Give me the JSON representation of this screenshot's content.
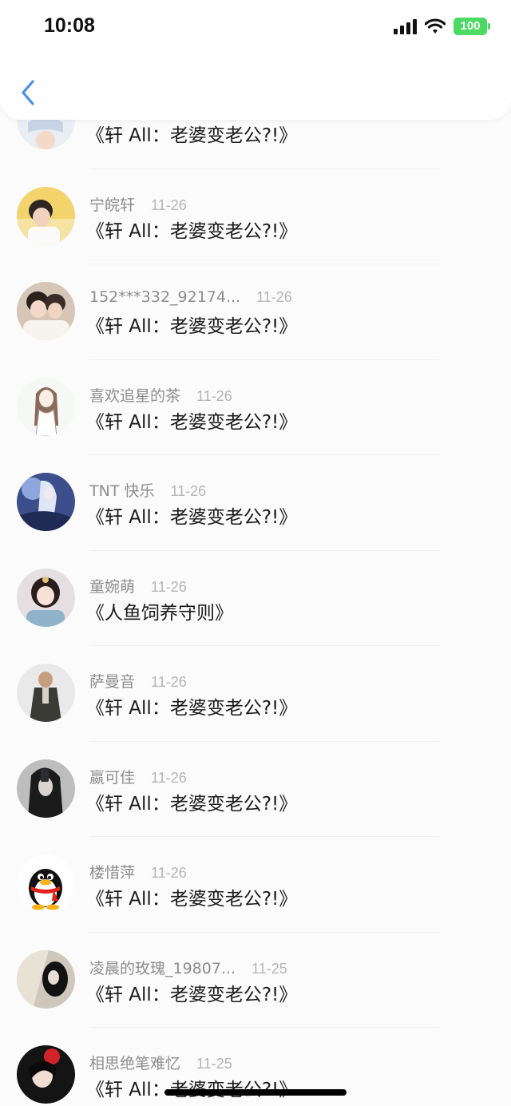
{
  "status_bar": {
    "time": "10:08",
    "battery": "100"
  },
  "colors": {
    "accent": "#4a90e2",
    "battery": "#4cd964",
    "username": "#8d8d8d",
    "date": "#b5b5b5",
    "message": "#1b1b1b"
  },
  "icons": {
    "back": "chevron-left-icon",
    "signal": "signal-icon",
    "wifi": "wifi-icon",
    "battery": "battery-icon"
  },
  "items": [
    {
      "username": "",
      "date": "",
      "message": "《轩 All：老婆变老公?!》",
      "avatar": "partial-avatar"
    },
    {
      "username": "宁皖轩",
      "date": "11-26",
      "message": "《轩 All：老婆变老公?!》",
      "avatar": "photo-avatar"
    },
    {
      "username": "152***332_92174...",
      "date": "11-26",
      "message": "《轩 All：老婆变老公?!》",
      "avatar": "photo-avatar"
    },
    {
      "username": "喜欢追星的茶",
      "date": "11-26",
      "message": "《轩 All：老婆变老公?!》",
      "avatar": "sketch-avatar"
    },
    {
      "username": "TNT 快乐",
      "date": "11-26",
      "message": "《轩 All：老婆变老公?!》",
      "avatar": "anime-avatar"
    },
    {
      "username": "童婉萌",
      "date": "11-26",
      "message": "《人鱼饲养守则》",
      "avatar": "photo-avatar"
    },
    {
      "username": "萨曼音",
      "date": "11-26",
      "message": "《轩 All：老婆变老公?!》",
      "avatar": "game-character-avatar"
    },
    {
      "username": "嬴可佳",
      "date": "11-26",
      "message": "《轩 All：老婆变老公?!》",
      "avatar": "photo-avatar"
    },
    {
      "username": "楼惜萍",
      "date": "11-26",
      "message": "《轩 All：老婆变老公?!》",
      "avatar": "penguin-avatar"
    },
    {
      "username": "凌晨的玫瑰_19807...",
      "date": "11-25",
      "message": "《轩 All：老婆变老公?!》",
      "avatar": "photo-avatar"
    },
    {
      "username": "相思绝笔难忆",
      "date": "11-25",
      "message": "《轩 All：老婆变老公?!》",
      "avatar": "photo-avatar"
    }
  ]
}
